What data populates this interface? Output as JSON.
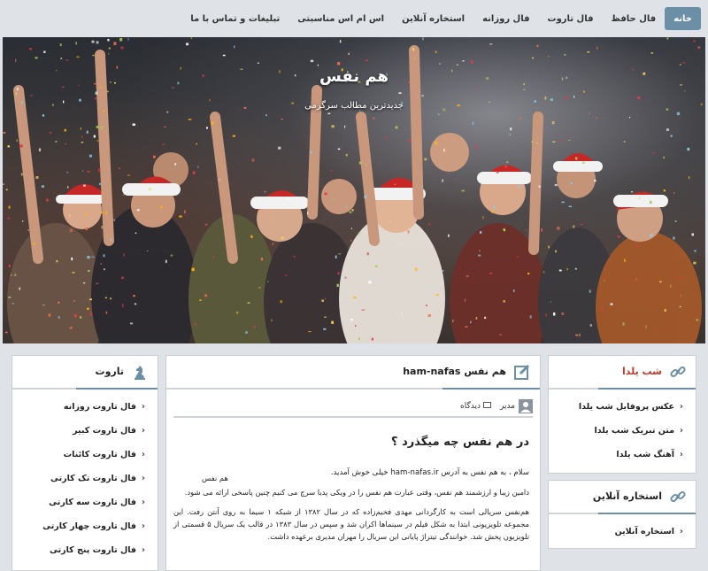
{
  "nav": {
    "items": [
      {
        "label": "خانه",
        "active": true
      },
      {
        "label": "فال حافظ"
      },
      {
        "label": "فال تاروت"
      },
      {
        "label": "فال روزانه"
      },
      {
        "label": "استخاره آنلاین"
      },
      {
        "label": "اس ام اس مناسبتی"
      },
      {
        "label": "تبلیغات و تماس با ما"
      }
    ]
  },
  "hero": {
    "title": "هم نفس",
    "tagline": "جدیدترین مطالب سرگرمی"
  },
  "right_sidebar": {
    "yalda": {
      "title": "شب یلدا",
      "items": [
        "عکس پروفایل شب یلدا",
        "متن تبریک شب یلدا",
        "آهنگ شب یلدا"
      ]
    },
    "estekhare": {
      "title": "استخاره آنلاین",
      "items": [
        "استخاره آنلاین"
      ]
    }
  },
  "left_sidebar": {
    "title": "تاروت",
    "items": [
      "فال تاروت روزانه",
      "فال تاروت کبیر",
      "فال تاروت کائنات",
      "فال تاروت تک کارتی",
      "فال تاروت سه کارتی",
      "فال تاروت چهار کارتی",
      "فال تاروت پنج کارتی"
    ]
  },
  "article": {
    "title": "هم نفس ham-nafas",
    "author": "مدیر",
    "views": "دیدگاه",
    "heading": "در هم نفس چه میگذرد ؟",
    "p1": "سلام ، به هم نفس به آدرس ham-nafas.ir خیلی خوش آمدید.",
    "p1b": "هم نفس",
    "p2": "دامین زیبا و ارزشمند هم نفس، وقتی عبارت هم نفس را در ویکی پدیا سرچ می کنیم چنین پاسخی ارائه می شود.",
    "p3": "هم‌نفس سریالی است به کارگردانی مهدی فخیم‌زاده که در سال ۱۳۸۲ از شبکه ۱ سیما به روی آنتن رفت. این مجموعه تلویزیونی ابتدا به شکل فیلم در سینماها اکران شد و سپس در سال ۱۳۸۳ در قالب یک سریال ۵ قسمتی از تلویزیون پخش شد. خوانندگی تیتراژ پایانی این سریال را مهران مدیری برعهده داشت."
  },
  "colors": {
    "accent": "#6b8fa6",
    "red": "#c0392b"
  }
}
